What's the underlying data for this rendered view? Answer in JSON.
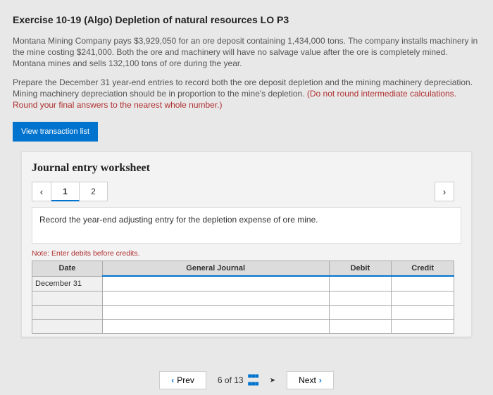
{
  "title": "Exercise 10-19 (Algo) Depletion of natural resources LO P3",
  "problem": "Montana Mining Company pays $3,929,050 for an ore deposit containing 1,434,000 tons. The company installs machinery in the mine costing $241,000. Both the ore and machinery will have no salvage value after the ore is completely mined. Montana mines and sells 132,100 tons of ore during the year.",
  "instruction1": "Prepare the December 31 year-end entries to record both the ore deposit depletion and the mining machinery depreciation. Mining machinery depreciation should be in proportion to the mine's depletion. ",
  "instruction_red": "(Do not round intermediate calculations. Round your final answers to the nearest whole number.)",
  "view_btn": "View transaction list",
  "worksheet": {
    "title": "Journal entry worksheet",
    "tabs": [
      "1",
      "2"
    ],
    "instruction": "Record the year-end adjusting entry for the depletion expense of ore mine.",
    "note": "Note: Enter debits before credits.",
    "headers": {
      "date": "Date",
      "gj": "General Journal",
      "debit": "Debit",
      "credit": "Credit"
    },
    "date_value": "December 31"
  },
  "footer": {
    "prev": "Prev",
    "position": "6 of 13",
    "next": "Next"
  }
}
